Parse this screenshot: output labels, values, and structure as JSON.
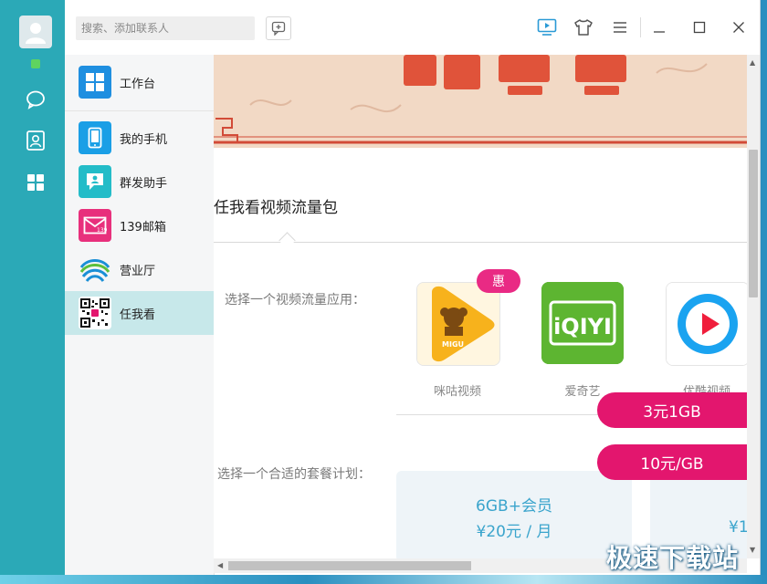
{
  "search": {
    "placeholder": "搜索、添加联系人"
  },
  "sidebar": {
    "items": [
      {
        "label": "工作台",
        "icon": "grid-icon"
      },
      {
        "label": "我的手机",
        "icon": "phone-icon"
      },
      {
        "label": "群发助手",
        "icon": "chat-user-icon"
      },
      {
        "label": "139邮箱",
        "icon": "mail-icon",
        "badge": "139"
      },
      {
        "label": "营业厅",
        "icon": "china-mobile-logo-icon"
      },
      {
        "label": "任我看",
        "icon": "qrcode-icon"
      }
    ]
  },
  "main": {
    "title": "任我看视频流量包",
    "choose_app_label": "选择一个视频流量应用：",
    "choose_plan_label": "选择一个合适的套餐计划：",
    "apps": [
      {
        "name": "咪咕视频",
        "logo_text": "MIGU"
      },
      {
        "name": "爱奇艺",
        "logo_text": "iQIYI"
      },
      {
        "name": "优酷视频"
      }
    ],
    "badge": "惠",
    "plans": [
      {
        "line1": "6GB+会员",
        "line2": "¥20元 / 月"
      },
      {
        "line2": "¥1"
      }
    ],
    "pills": [
      "3元1GB",
      "10元/GB"
    ]
  },
  "watermark": "极速下载站",
  "colors": {
    "accent": "#2ba9b7",
    "pink": "#e3166e",
    "plan_text": "#3aa4cc"
  }
}
